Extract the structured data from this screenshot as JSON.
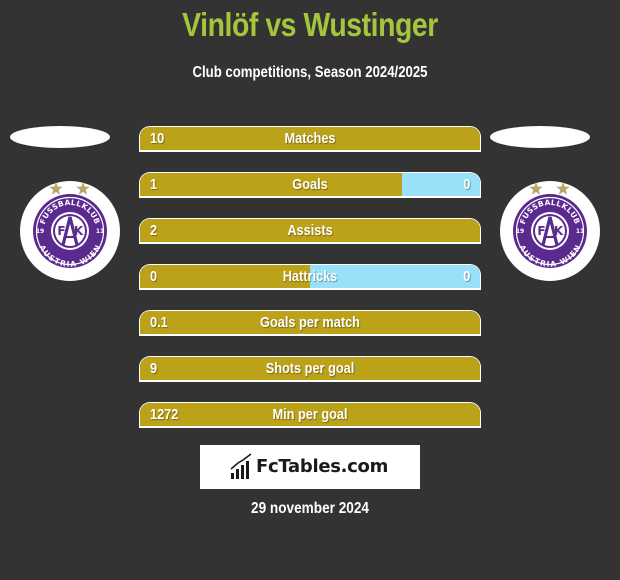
{
  "header": {
    "title": "Vinlöf vs Wustinger",
    "subtitle": "Club competitions, Season 2024/2025"
  },
  "colors": {
    "title": "#a4c63c",
    "left_bar": "#bba218",
    "right_bar": "#99e1f8",
    "background": "#333333",
    "badge_purple": "#5b2a8f",
    "star_gold": "#b8a66a"
  },
  "players": {
    "left": {
      "name": "Vinlöf",
      "club_badge": "fk-austria-wien-badge"
    },
    "right": {
      "name": "Wustinger",
      "club_badge": "fk-austria-wien-badge"
    }
  },
  "badge": {
    "top_text": "FUSSBALLKLUB",
    "bottom_text": "AUSTRIA WIEN",
    "year_left": "19",
    "year_right": "11",
    "letters": "FAK"
  },
  "stats": [
    {
      "label": "Matches",
      "left": "10",
      "right": "",
      "left_share": 1.0
    },
    {
      "label": "Goals",
      "left": "1",
      "right": "0",
      "left_share": 0.77
    },
    {
      "label": "Assists",
      "left": "2",
      "right": "",
      "left_share": 1.0
    },
    {
      "label": "Hattricks",
      "left": "0",
      "right": "0",
      "left_share": 0.5
    },
    {
      "label": "Goals per match",
      "left": "0.1",
      "right": "",
      "left_share": 1.0
    },
    {
      "label": "Shots per goal",
      "left": "9",
      "right": "",
      "left_share": 1.0
    },
    {
      "label": "Min per goal",
      "left": "1272",
      "right": "",
      "left_share": 1.0
    }
  ],
  "footer": {
    "brand": "FcTables.com",
    "brand_icon": "bar-chart-trend-icon",
    "date": "29 november 2024"
  }
}
